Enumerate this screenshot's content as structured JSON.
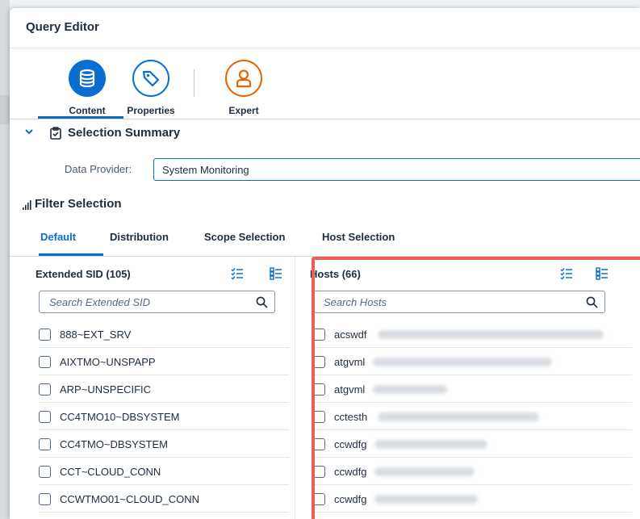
{
  "dialog": {
    "title": "Query Editor"
  },
  "tabs": [
    {
      "label": "Content",
      "icon": "database-icon",
      "active": true
    },
    {
      "label": "Properties",
      "icon": "tag-icon"
    },
    {
      "label": "Expert",
      "icon": "user-icon"
    }
  ],
  "summary": {
    "title": "Selection Summary"
  },
  "data_provider": {
    "label": "Data Provider:",
    "value": "System Monitoring"
  },
  "filter": {
    "title": "Filter Selection"
  },
  "subtabs": [
    "Default",
    "Distribution",
    "Scope Selection",
    "Host Selection"
  ],
  "extended_sid": {
    "title": "Extended SID (105)",
    "search_placeholder": "Search Extended SID",
    "items": [
      "888~EXT_SRV",
      "AIXTMO~UNSPAPP",
      "ARP~UNSPECIFIC",
      "CC4TMO10~DBSYSTEM",
      "CC4TMO~DBSYSTEM",
      "CCT~CLOUD_CONN",
      "CCWTMO01~CLOUD_CONN"
    ]
  },
  "hosts": {
    "title": "Hosts (66)",
    "search_placeholder": "Search Hosts",
    "items": [
      "acswdf",
      "atgvml",
      "atgvml",
      "cctesth",
      "ccwdfg",
      "ccwdfg",
      "ccwdfg"
    ]
  },
  "colors": {
    "accent": "#0a6ed1",
    "expert": "#e76500",
    "highlight": "#ea5f5a"
  }
}
